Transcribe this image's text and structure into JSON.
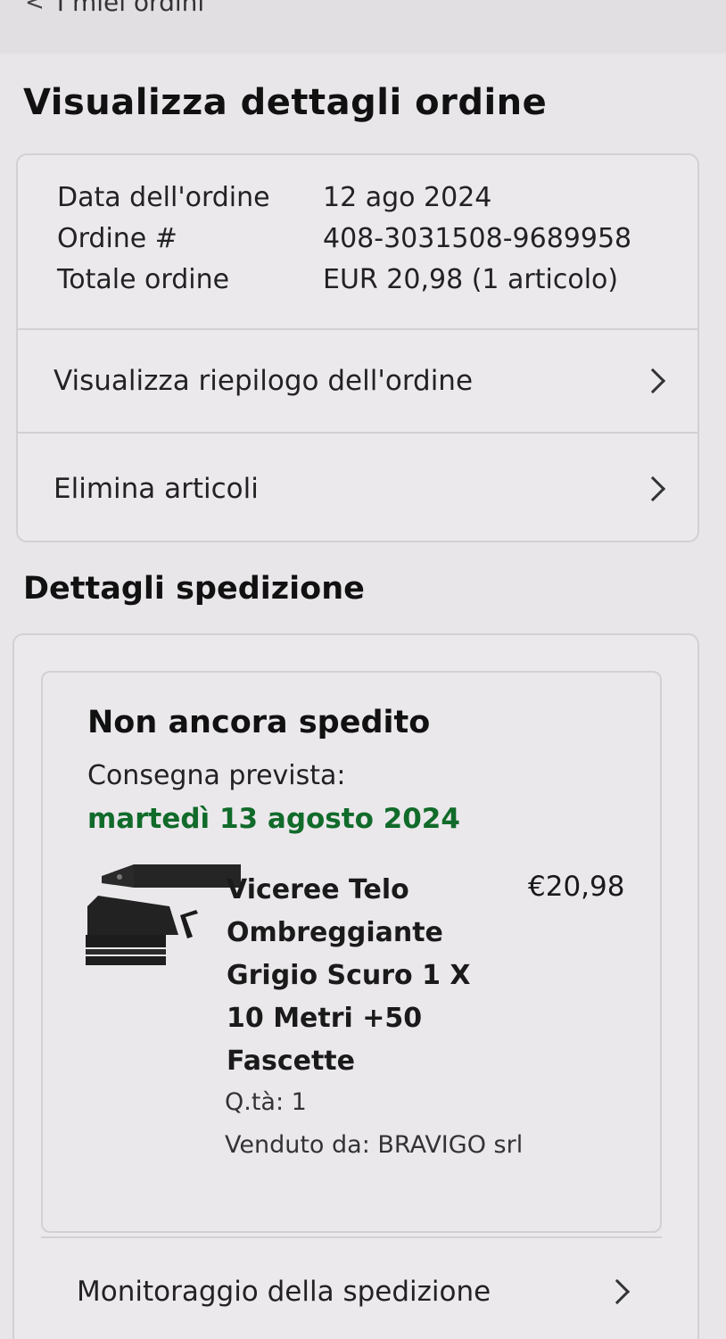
{
  "header": {
    "back_label": "I miei ordini"
  },
  "page_title": "Visualizza dettagli ordine",
  "order_info": {
    "date_label": "Data dell'ordine",
    "date_value": "12 ago 2024",
    "number_label": "Ordine #",
    "number_value": "408-3031508-9689958",
    "total_label": "Totale ordine",
    "total_value": "EUR 20,98 (1 articolo)"
  },
  "actions": {
    "summary_label": "Visualizza riepilogo dell'ordine",
    "delete_label": "Elimina articoli"
  },
  "shipping": {
    "section_title": "Dettagli spedizione",
    "status": "Non ancora spedito",
    "delivery_label": "Consegna prevista:",
    "delivery_date": "martedì 13 agosto 2024",
    "product": {
      "name": "Viceree Telo Ombreggiante Grigio Scuro 1 X 10 Metri +50 Fascette",
      "price": "€20,98",
      "quantity": "Q.tà: 1",
      "seller": "Venduto da: BRAVIGO srl"
    },
    "tracking_label": "Monitoraggio della spedizione"
  },
  "colors": {
    "delivery_green": "#116b2a",
    "background": "#e9e6ea"
  }
}
